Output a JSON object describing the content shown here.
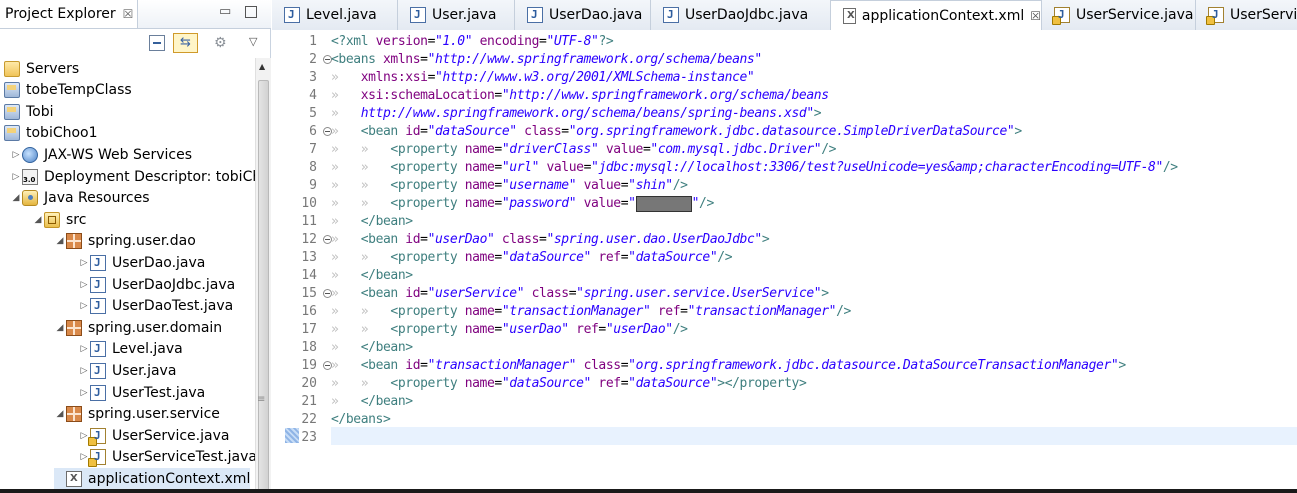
{
  "project_explorer": {
    "title": "Project Explorer",
    "close_glyph": "☒",
    "minimize_glyph": "▭",
    "toolbar": {
      "link_glyph": "⇆",
      "gear_glyph": "⚙",
      "menu_glyph": "▽"
    },
    "tree": [
      {
        "label": "Servers",
        "icon": "folder-icon",
        "depth": 0,
        "twisty": ""
      },
      {
        "label": "tobeTempClass",
        "icon": "project-icon",
        "depth": 0,
        "twisty": ""
      },
      {
        "label": "Tobi",
        "icon": "project-icon",
        "depth": 0,
        "twisty": ""
      },
      {
        "label": "tobiChoo1",
        "icon": "project-icon",
        "depth": 0,
        "twisty": ""
      },
      {
        "label": "JAX-WS Web Services",
        "icon": "webservice-icon",
        "depth": 1,
        "twisty": "▷"
      },
      {
        "label": "Deployment Descriptor: tobiCh",
        "icon": "deployment-descriptor-icon",
        "depth": 1,
        "twisty": "▷"
      },
      {
        "label": "Java Resources",
        "icon": "java-resources-icon",
        "depth": 1,
        "twisty": "◢"
      },
      {
        "label": "src",
        "icon": "source-folder-icon",
        "depth": 2,
        "twisty": "◢"
      },
      {
        "label": "spring.user.dao",
        "icon": "package-icon",
        "depth": 3,
        "twisty": "◢"
      },
      {
        "label": "UserDao.java",
        "icon": "java-file-icon",
        "depth": 4,
        "twisty": "▷"
      },
      {
        "label": "UserDaoJdbc.java",
        "icon": "java-file-icon",
        "depth": 4,
        "twisty": "▷"
      },
      {
        "label": "UserDaoTest.java",
        "icon": "java-file-icon",
        "depth": 4,
        "twisty": "▷"
      },
      {
        "label": "spring.user.domain",
        "icon": "package-icon",
        "depth": 3,
        "twisty": "◢"
      },
      {
        "label": "Level.java",
        "icon": "java-file-icon",
        "depth": 4,
        "twisty": "▷"
      },
      {
        "label": "User.java",
        "icon": "java-file-icon",
        "depth": 4,
        "twisty": "▷"
      },
      {
        "label": "UserTest.java",
        "icon": "java-file-icon",
        "depth": 4,
        "twisty": "▷"
      },
      {
        "label": "spring.user.service",
        "icon": "package-icon",
        "depth": 3,
        "twisty": "◢"
      },
      {
        "label": "UserService.java",
        "icon": "java-file-warning-icon",
        "depth": 4,
        "twisty": "▷"
      },
      {
        "label": "UserServiceTest.java",
        "icon": "java-file-warning-icon",
        "depth": 4,
        "twisty": "▷"
      },
      {
        "label": "applicationContext.xml",
        "icon": "xml-file-icon",
        "depth": 3,
        "twisty": ""
      }
    ]
  },
  "editor": {
    "tabs": [
      {
        "label": "Level.java",
        "icon": "java-file-icon",
        "active": false
      },
      {
        "label": "User.java",
        "icon": "java-file-icon",
        "active": false
      },
      {
        "label": "UserDao.java",
        "icon": "java-file-icon",
        "active": false
      },
      {
        "label": "UserDaoJdbc.java",
        "icon": "java-file-icon",
        "active": false
      },
      {
        "label": "applicationContext.xml",
        "icon": "xml-file-icon",
        "active": true,
        "close": "☒"
      },
      {
        "label": "UserService.java",
        "icon": "java-file-warning-icon",
        "active": false
      },
      {
        "label": "UserServic",
        "icon": "java-file-warning-icon",
        "active": false
      }
    ],
    "lines": [
      {
        "n": "1",
        "fold": false,
        "indent": 0,
        "tokens": [
          [
            "t-pi",
            "<?xml "
          ],
          [
            "t-attr",
            "version"
          ],
          [
            "t-punct",
            "="
          ],
          [
            "t-val",
            "\"1.0\""
          ],
          [
            "t-punct",
            " "
          ],
          [
            "t-attr",
            "encoding"
          ],
          [
            "t-punct",
            "="
          ],
          [
            "t-val",
            "\"UTF-8\""
          ],
          [
            "t-pi",
            "?>"
          ]
        ]
      },
      {
        "n": "2",
        "fold": true,
        "indent": 0,
        "tokens": [
          [
            "t-tag",
            "<beans "
          ],
          [
            "t-attr",
            "xmlns"
          ],
          [
            "t-punct",
            "="
          ],
          [
            "t-val",
            "\"http://www.springframework.org/schema/beans\""
          ]
        ]
      },
      {
        "n": "3",
        "fold": false,
        "indent": 0,
        "tokens": [
          [
            "t-ws",
            "»   "
          ],
          [
            "t-attr",
            "xmlns:xsi"
          ],
          [
            "t-punct",
            "="
          ],
          [
            "t-val",
            "\"http://www.w3.org/2001/XMLSchema-instance\""
          ]
        ]
      },
      {
        "n": "4",
        "fold": false,
        "indent": 0,
        "tokens": [
          [
            "t-ws",
            "»   "
          ],
          [
            "t-attr",
            "xsi:schemaLocation"
          ],
          [
            "t-punct",
            "="
          ],
          [
            "t-val",
            "\"http://www.springframework.org/schema/beans"
          ]
        ]
      },
      {
        "n": "5",
        "fold": false,
        "indent": 0,
        "tokens": [
          [
            "t-ws",
            "»   "
          ],
          [
            "t-val",
            "http://www.springframework.org/schema/beans/spring-beans.xsd\""
          ],
          [
            "t-tag",
            ">"
          ]
        ]
      },
      {
        "n": "6",
        "fold": true,
        "indent": 0,
        "tokens": [
          [
            "t-ws",
            "»   "
          ],
          [
            "t-tag",
            "<bean "
          ],
          [
            "t-attr",
            "id"
          ],
          [
            "t-punct",
            "="
          ],
          [
            "t-val",
            "\"dataSource\""
          ],
          [
            "t-punct",
            " "
          ],
          [
            "t-attr",
            "class"
          ],
          [
            "t-punct",
            "="
          ],
          [
            "t-val",
            "\"org.springframework.jdbc.datasource.SimpleDriverDataSource\""
          ],
          [
            "t-tag",
            ">"
          ]
        ]
      },
      {
        "n": "7",
        "fold": false,
        "indent": 0,
        "tokens": [
          [
            "t-ws",
            "»   »   "
          ],
          [
            "t-tag",
            "<property "
          ],
          [
            "t-attr",
            "name"
          ],
          [
            "t-punct",
            "="
          ],
          [
            "t-val",
            "\"driverClass\""
          ],
          [
            "t-punct",
            " "
          ],
          [
            "t-attr",
            "value"
          ],
          [
            "t-punct",
            "="
          ],
          [
            "t-val",
            "\"com.mysql.jdbc.Driver\""
          ],
          [
            "t-tag",
            "/>"
          ]
        ]
      },
      {
        "n": "8",
        "fold": false,
        "indent": 0,
        "tokens": [
          [
            "t-ws",
            "»   »   "
          ],
          [
            "t-tag",
            "<property "
          ],
          [
            "t-attr",
            "name"
          ],
          [
            "t-punct",
            "="
          ],
          [
            "t-val",
            "\"url\""
          ],
          [
            "t-punct",
            " "
          ],
          [
            "t-attr",
            "value"
          ],
          [
            "t-punct",
            "="
          ],
          [
            "t-val",
            "\"jdbc:mysql://localhost:3306/test?useUnicode=yes&amp;characterEncoding=UTF-8\""
          ],
          [
            "t-tag",
            "/>"
          ]
        ]
      },
      {
        "n": "9",
        "fold": false,
        "indent": 0,
        "tokens": [
          [
            "t-ws",
            "»   »   "
          ],
          [
            "t-tag",
            "<property "
          ],
          [
            "t-attr",
            "name"
          ],
          [
            "t-punct",
            "="
          ],
          [
            "t-val",
            "\"username\""
          ],
          [
            "t-punct",
            " "
          ],
          [
            "t-attr",
            "value"
          ],
          [
            "t-punct",
            "="
          ],
          [
            "t-val",
            "\"shin\""
          ],
          [
            "t-tag",
            "/>"
          ]
        ]
      },
      {
        "n": "10",
        "fold": false,
        "indent": 0,
        "tokens": [
          [
            "t-ws",
            "»   »   "
          ],
          [
            "t-tag",
            "<property "
          ],
          [
            "t-attr",
            "name"
          ],
          [
            "t-punct",
            "="
          ],
          [
            "t-val",
            "\"password\""
          ],
          [
            "t-punct",
            " "
          ],
          [
            "t-attr",
            "value"
          ],
          [
            "t-punct",
            "="
          ],
          [
            "t-val",
            "\""
          ],
          [
            "redact",
            ""
          ],
          [
            "t-val",
            "\""
          ],
          [
            "t-tag",
            "/>"
          ]
        ]
      },
      {
        "n": "11",
        "fold": false,
        "indent": 0,
        "tokens": [
          [
            "t-ws",
            "»   "
          ],
          [
            "t-tag",
            "</bean>"
          ]
        ]
      },
      {
        "n": "12",
        "fold": true,
        "indent": 0,
        "tokens": [
          [
            "t-ws",
            "»   "
          ],
          [
            "t-tag",
            "<bean "
          ],
          [
            "t-attr",
            "id"
          ],
          [
            "t-punct",
            "="
          ],
          [
            "t-val",
            "\"userDao\""
          ],
          [
            "t-punct",
            " "
          ],
          [
            "t-attr",
            "class"
          ],
          [
            "t-punct",
            "="
          ],
          [
            "t-val",
            "\"spring.user.dao.UserDaoJdbc\""
          ],
          [
            "t-tag",
            ">"
          ]
        ]
      },
      {
        "n": "13",
        "fold": false,
        "indent": 0,
        "tokens": [
          [
            "t-ws",
            "»   »   "
          ],
          [
            "t-tag",
            "<property "
          ],
          [
            "t-attr",
            "name"
          ],
          [
            "t-punct",
            "="
          ],
          [
            "t-val",
            "\"dataSource\""
          ],
          [
            "t-punct",
            " "
          ],
          [
            "t-attr",
            "ref"
          ],
          [
            "t-punct",
            "="
          ],
          [
            "t-val",
            "\"dataSource\""
          ],
          [
            "t-tag",
            "/>"
          ]
        ]
      },
      {
        "n": "14",
        "fold": false,
        "indent": 0,
        "tokens": [
          [
            "t-ws",
            "»   "
          ],
          [
            "t-tag",
            "</bean>"
          ]
        ]
      },
      {
        "n": "15",
        "fold": true,
        "indent": 0,
        "tokens": [
          [
            "t-ws",
            "»   "
          ],
          [
            "t-tag",
            "<bean "
          ],
          [
            "t-attr",
            "id"
          ],
          [
            "t-punct",
            "="
          ],
          [
            "t-val",
            "\"userService\""
          ],
          [
            "t-punct",
            " "
          ],
          [
            "t-attr",
            "class"
          ],
          [
            "t-punct",
            "="
          ],
          [
            "t-val",
            "\"spring.user.service.UserService\""
          ],
          [
            "t-tag",
            ">"
          ]
        ]
      },
      {
        "n": "16",
        "fold": false,
        "indent": 0,
        "tokens": [
          [
            "t-ws",
            "»   »   "
          ],
          [
            "t-tag",
            "<property "
          ],
          [
            "t-attr",
            "name"
          ],
          [
            "t-punct",
            "="
          ],
          [
            "t-val",
            "\"transactionManager\""
          ],
          [
            "t-punct",
            " "
          ],
          [
            "t-attr",
            "ref"
          ],
          [
            "t-punct",
            "="
          ],
          [
            "t-val",
            "\"transactionManager\""
          ],
          [
            "t-tag",
            "/>"
          ]
        ]
      },
      {
        "n": "17",
        "fold": false,
        "indent": 0,
        "tokens": [
          [
            "t-ws",
            "»   »   "
          ],
          [
            "t-tag",
            "<property "
          ],
          [
            "t-attr",
            "name"
          ],
          [
            "t-punct",
            "="
          ],
          [
            "t-val",
            "\"userDao\""
          ],
          [
            "t-punct",
            " "
          ],
          [
            "t-attr",
            "ref"
          ],
          [
            "t-punct",
            "="
          ],
          [
            "t-val",
            "\"userDao\""
          ],
          [
            "t-tag",
            "/>"
          ]
        ]
      },
      {
        "n": "18",
        "fold": false,
        "indent": 0,
        "tokens": [
          [
            "t-ws",
            "»   "
          ],
          [
            "t-tag",
            "</bean>"
          ]
        ]
      },
      {
        "n": "19",
        "fold": true,
        "indent": 0,
        "tokens": [
          [
            "t-ws",
            "»   "
          ],
          [
            "t-tag",
            "<bean "
          ],
          [
            "t-attr",
            "id"
          ],
          [
            "t-punct",
            "="
          ],
          [
            "t-val",
            "\"transactionManager\""
          ],
          [
            "t-punct",
            " "
          ],
          [
            "t-attr",
            "class"
          ],
          [
            "t-punct",
            "="
          ],
          [
            "t-val",
            "\"org.springframework.jdbc.datasource.DataSourceTransactionManager\""
          ],
          [
            "t-tag",
            ">"
          ]
        ]
      },
      {
        "n": "20",
        "fold": false,
        "indent": 0,
        "tokens": [
          [
            "t-ws",
            "»   »   "
          ],
          [
            "t-tag",
            "<property "
          ],
          [
            "t-attr",
            "name"
          ],
          [
            "t-punct",
            "="
          ],
          [
            "t-val",
            "\"dataSource\""
          ],
          [
            "t-punct",
            " "
          ],
          [
            "t-attr",
            "ref"
          ],
          [
            "t-punct",
            "="
          ],
          [
            "t-val",
            "\"dataSource\""
          ],
          [
            "t-tag",
            "></property>"
          ]
        ]
      },
      {
        "n": "21",
        "fold": false,
        "indent": 0,
        "tokens": [
          [
            "t-ws",
            "»   "
          ],
          [
            "t-tag",
            "</bean>"
          ]
        ]
      },
      {
        "n": "22",
        "fold": false,
        "indent": 0,
        "tokens": [
          [
            "t-tag",
            "</beans>"
          ]
        ]
      },
      {
        "n": "23",
        "fold": false,
        "indent": 0,
        "tokens": []
      }
    ]
  },
  "colors": {
    "tag": "#3f7f7f",
    "attribute": "#7f007f",
    "value": "#2a00ff",
    "current_line": "#e8f2fe"
  }
}
